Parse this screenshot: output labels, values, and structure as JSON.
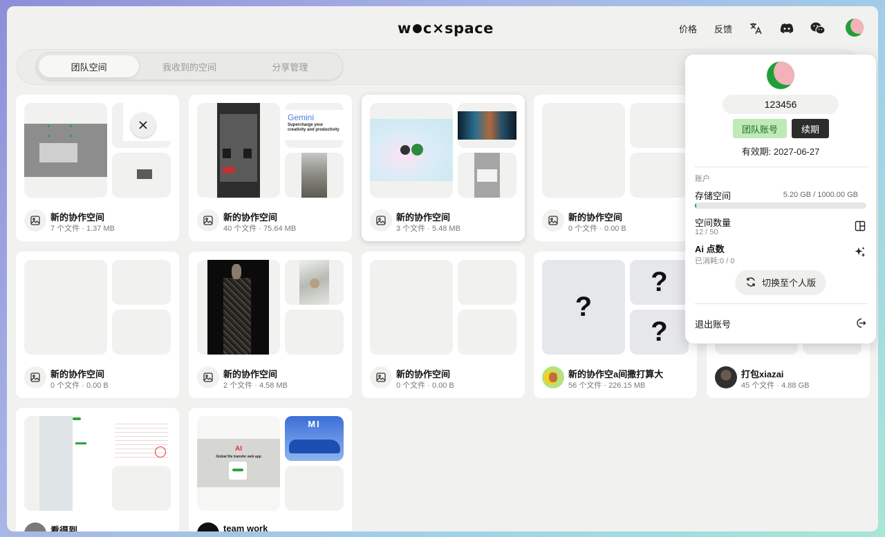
{
  "header": {
    "logo_left": "w",
    "logo_mid": "c",
    "logo_right": "×space",
    "nav": {
      "pricing": "价格",
      "feedback": "反馈"
    },
    "icons": [
      "translate-icon",
      "discord-icon",
      "wechat-icon"
    ]
  },
  "tabs": [
    {
      "label": "团队空间",
      "active": true
    },
    {
      "label": "我收到的空间",
      "active": false
    },
    {
      "label": "分享管理",
      "active": false
    }
  ],
  "cards": [
    {
      "title": "新的协作空间",
      "meta": "7 个文件 · 1.37 MB"
    },
    {
      "title": "新的协作空间",
      "meta": "40 个文件 · 75.64 MB"
    },
    {
      "title": "新的协作空间",
      "meta": "3 个文件 · 5.48 MB"
    },
    {
      "title": "新的协作空间",
      "meta": "0 个文件 · 0.00 B"
    },
    {
      "title": "新的协作空间",
      "meta": "0 个文件 · 0.00 B"
    },
    {
      "title": "新的协作空间",
      "meta": "2 个文件 · 4.58 MB"
    },
    {
      "title": "新的协作空间",
      "meta": "0 个文件 · 0.00 B"
    },
    {
      "title": "新的协作空a间撒打算大",
      "meta": "56 个文件 · 226.15 MB"
    },
    {
      "title": "打包xiazai",
      "meta": "45 个文件 · 4.88 GB"
    },
    {
      "title": "看得到",
      "meta": ""
    },
    {
      "title": "team work",
      "meta": ""
    }
  ],
  "thumb_text": {
    "gemini_brand": "Gemini",
    "gemini_tagline": "Supercharge your creativity and productivity",
    "mi_brand": "MI",
    "ai_title": "AI",
    "ai_subtitle": "Global file transfer web app",
    "question": "?"
  },
  "popover": {
    "user_id": "123456",
    "badge": "团队账号",
    "renew": "续期",
    "expiry": "有效期: 2027-06-27",
    "section": "账户",
    "storage_label": "存储空间",
    "storage_value": "5.20 GB / 1000.00 GB",
    "storage_fraction": 0.0052,
    "spaces_label": "空间数量",
    "spaces_value": "12 / 50",
    "ai_label": "Ai 点数",
    "ai_value": "已消耗:0 / 0",
    "switch": "切换至个人版",
    "logout": "退出账号"
  },
  "colors": {
    "accent_green": "#1f9f3a",
    "badge_bg": "#bfeab8",
    "dark_button": "#2b2d2b"
  }
}
